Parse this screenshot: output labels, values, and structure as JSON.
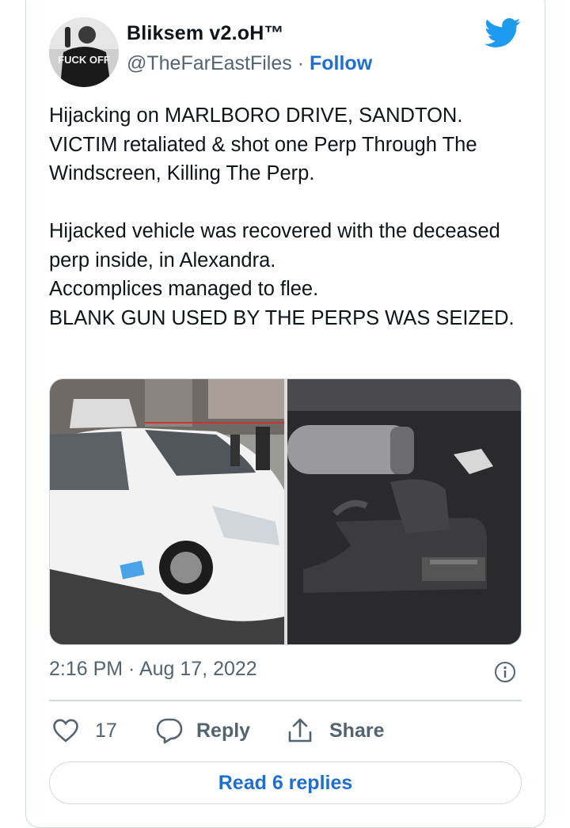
{
  "tweet": {
    "display_name": "Bliksem v2.oH™",
    "handle": "@TheFarEastFiles",
    "separator": "·",
    "follow_label": "Follow",
    "avatar_text": "FUCK OFF",
    "text": "Hijacking on MARLBORO DRIVE, SANDTON.\nVICTIM retaliated & shot one Perp Through The Windscreen, Killing The Perp.\n\nHijacked vehicle was recovered with the deceased perp inside, in Alexandra.\nAccomplices managed to flee.\nBLANK GUN USED BY THE PERPS WAS SEIZED.",
    "timestamp": "2:16 PM · Aug 17, 2022"
  },
  "actions": {
    "like_count": "17",
    "reply_label": "Reply",
    "share_label": "Share"
  },
  "read_replies_label": "Read 6 replies",
  "colors": {
    "accent": "#1d6fd1",
    "twitter_blue": "#1d9bf0",
    "secondary_text": "#536471",
    "border": "#cfd9de"
  },
  "icons": [
    "twitter-bird-icon",
    "info-icon",
    "heart-icon",
    "reply-bubble-icon",
    "share-upload-icon"
  ]
}
